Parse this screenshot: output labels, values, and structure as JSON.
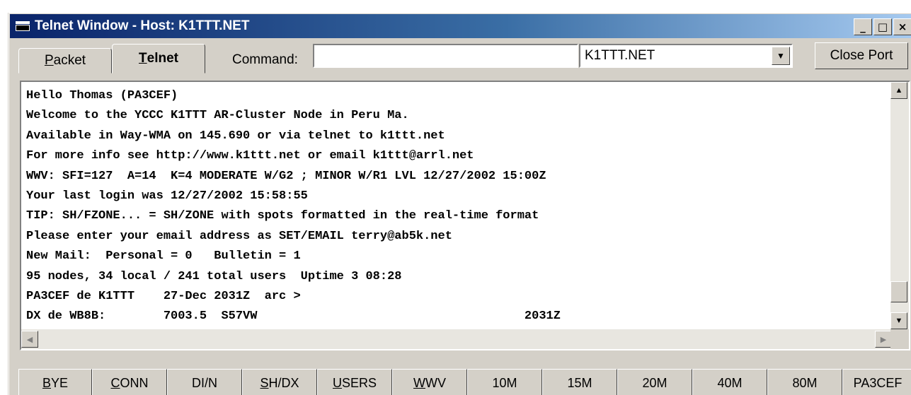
{
  "window": {
    "title": "Telnet Window - Host: K1TTT.NET",
    "controls": [
      "_",
      "□",
      "×"
    ]
  },
  "tabs": [
    {
      "label": "Packet",
      "accel": "P",
      "rest": "acket",
      "active": false
    },
    {
      "label": "Telnet",
      "accel": "T",
      "rest": "elnet",
      "active": true
    }
  ],
  "toolbar": {
    "command_label": "Command:",
    "command_value": "",
    "host_value": "K1TTT.NET",
    "close_port_label": "Close Port"
  },
  "terminal": {
    "lines": [
      "Hello Thomas (PA3CEF)",
      "Welcome to the YCCC K1TTT AR-Cluster Node in Peru Ma.",
      "Available in Way-WMA on 145.690 or via telnet to k1ttt.net",
      "For more info see http://www.k1ttt.net or email k1ttt@arrl.net",
      "WWV: SFI=127  A=14  K=4 MODERATE W/G2 ; MINOR W/R1 LVL 12/27/2002 15:00Z",
      "Your last login was 12/27/2002 15:58:55",
      "TIP: SH/FZONE... = SH/ZONE with spots formatted in the real-time format",
      "Please enter your email address as SET/EMAIL terry@ab5k.net",
      "New Mail:  Personal = 0   Bulletin = 1",
      "95 nodes, 34 local / 241 total users  Uptime 3 08:28",
      "PA3CEF de K1TTT    27-Dec 2031Z  arc >",
      "DX de WB8B:        7003.5  S57VW                                     2031Z"
    ]
  },
  "macro_buttons": [
    {
      "label": "BYE",
      "accel": "B",
      "rest": "YE"
    },
    {
      "label": "CONN",
      "accel": "C",
      "rest": "ONN"
    },
    {
      "label": "DI/N",
      "accel": "",
      "rest": "DI/N"
    },
    {
      "label": "SH/DX",
      "accel": "S",
      "rest": "H/DX"
    },
    {
      "label": "USERS",
      "accel": "U",
      "rest": "SERS"
    },
    {
      "label": "WWV",
      "accel": "W",
      "rest": "WV"
    },
    {
      "label": "10M",
      "accel": "",
      "rest": "10M"
    },
    {
      "label": "15M",
      "accel": "",
      "rest": "15M"
    },
    {
      "label": "20M",
      "accel": "",
      "rest": "20M"
    },
    {
      "label": "40M",
      "accel": "",
      "rest": "40M"
    },
    {
      "label": "80M",
      "accel": "",
      "rest": "80M"
    },
    {
      "label": "PA3CEF",
      "accel": "",
      "rest": "PA3CEF"
    }
  ]
}
